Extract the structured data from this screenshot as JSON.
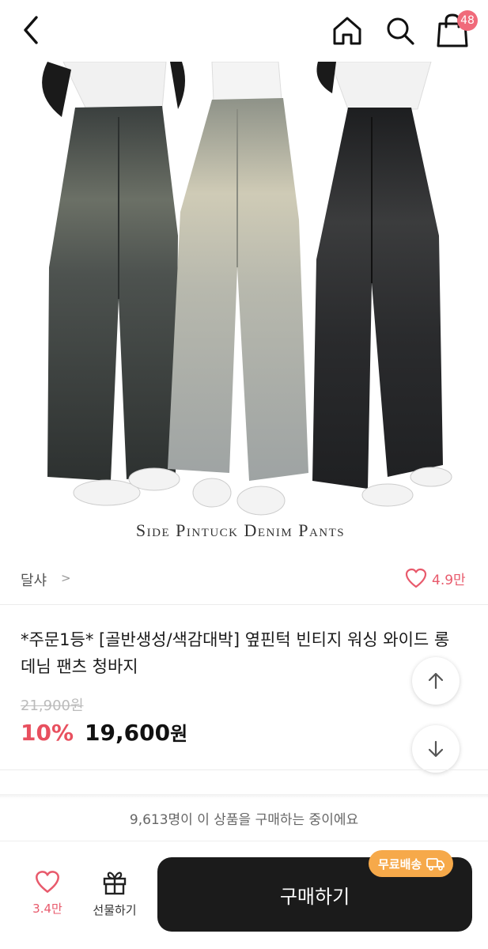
{
  "header": {
    "back_icon": "chevron-left-icon",
    "home_icon": "home-icon",
    "search_icon": "search-icon",
    "cart_icon": "shopping-bag-icon",
    "cart_count": "48"
  },
  "hero": {
    "caption": "Side Pintuck Denim Pants"
  },
  "brand": {
    "name": "달샤",
    "chevron": ">",
    "like_count": "4.9만"
  },
  "product": {
    "title": "*주문1등* [골반생성/색감대박] 옆핀턱 빈티지 워싱 와이드 롱 데님 팬츠 청바지",
    "original_price": "21,900원",
    "discount": "10%",
    "price": "19,600",
    "currency": "원"
  },
  "social_proof": "9,613명이 이 상품을 구매하는 중이에요",
  "action_bar": {
    "like_count": "3.4만",
    "gift_label": "선물하기",
    "buy_label": "구매하기",
    "shipping_badge": "무료배송"
  },
  "colors": {
    "accent": "#e8505f",
    "badge": "#f06a7a",
    "buy_button": "#1b1b1b",
    "shipping_badge": "#f6a94a"
  }
}
